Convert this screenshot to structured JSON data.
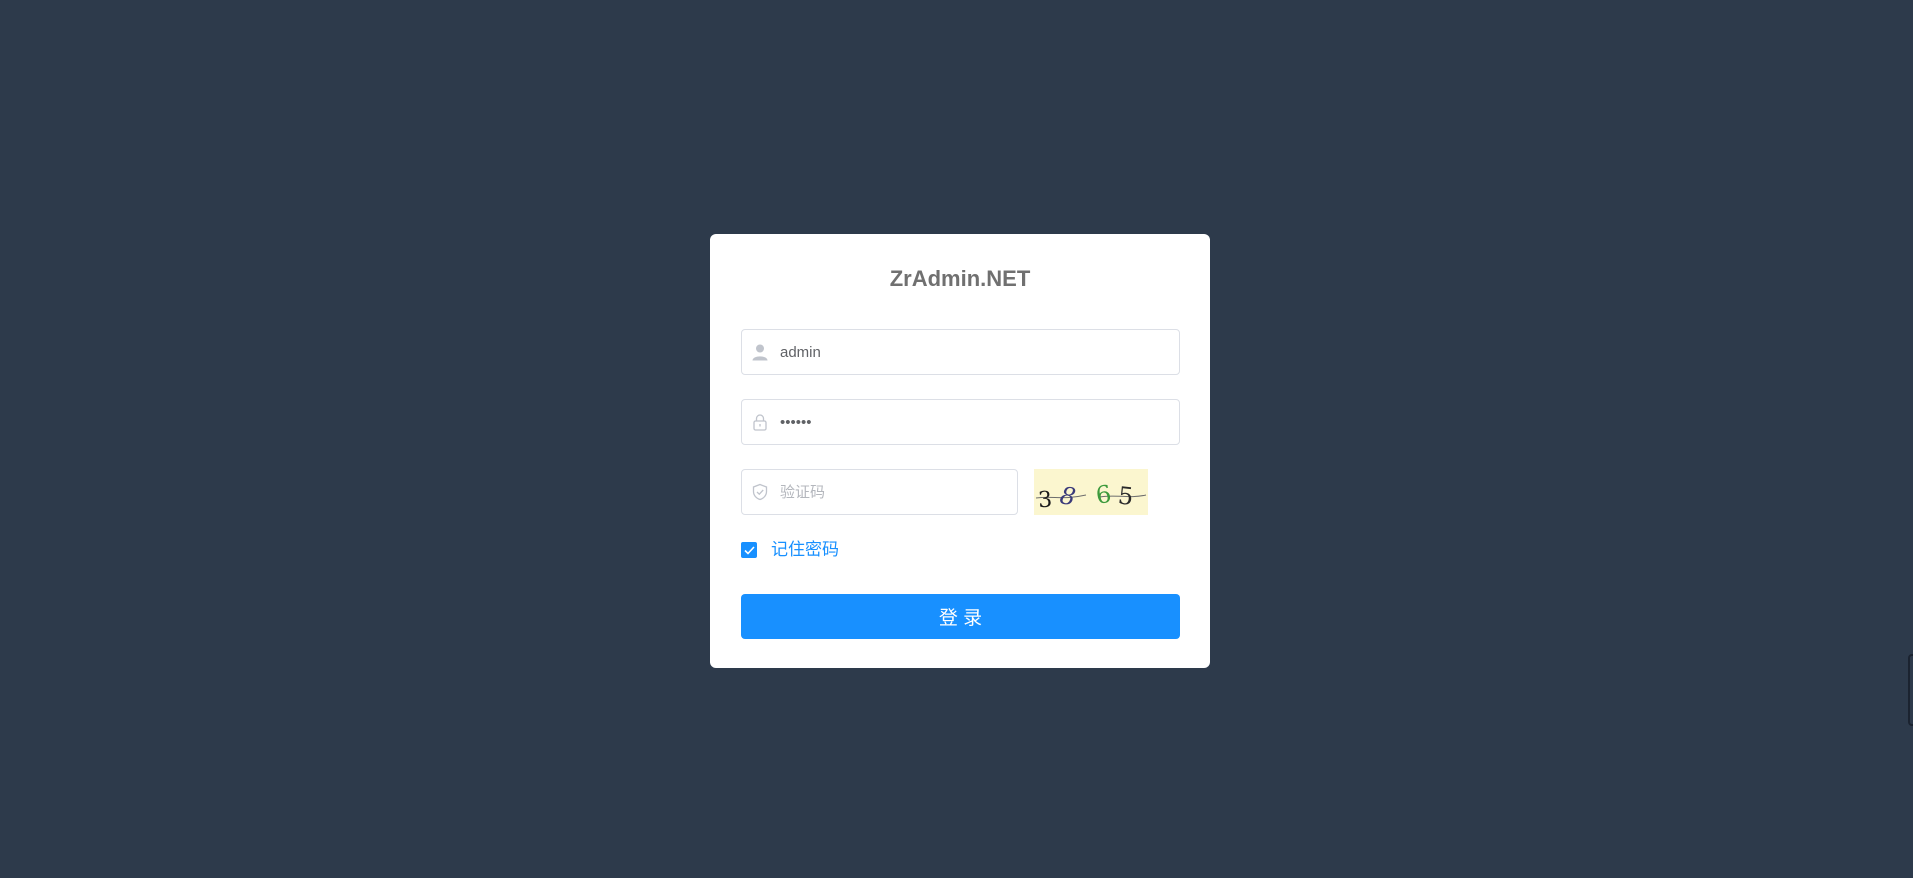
{
  "app": {
    "title": "ZrAdmin.NET"
  },
  "login_form": {
    "username": {
      "value": "admin",
      "icon": "user-icon"
    },
    "password": {
      "value": "123456",
      "icon": "lock-icon"
    },
    "captcha": {
      "value": "",
      "placeholder": "验证码",
      "icon": "shield-check-icon",
      "image_icon": "captcha-image",
      "image_text": "38 65"
    },
    "remember": {
      "label": "记住密码",
      "checked": true
    },
    "submit_label": "登 录"
  },
  "colors": {
    "page_background": "#2d3a4b",
    "card_background": "#ffffff",
    "accent": "#1890ff",
    "title_text": "#707070",
    "input_border": "#dcdfe6",
    "captcha_background": "#fbf6cf"
  }
}
